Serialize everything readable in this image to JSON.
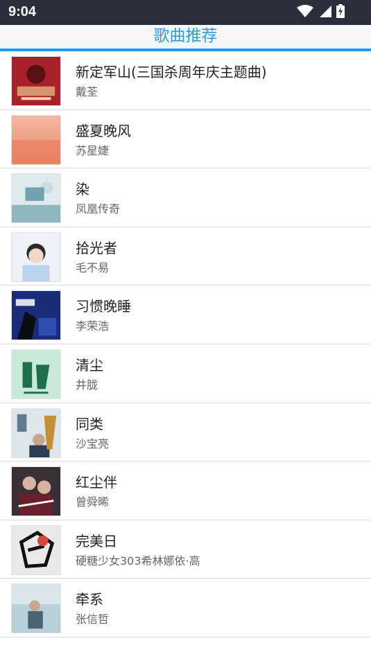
{
  "status_bar": {
    "time": "9:04",
    "icons": [
      "wifi-icon",
      "signal-icon",
      "battery-icon"
    ]
  },
  "header": {
    "title": "歌曲推荐",
    "accent_color": "#2196f3",
    "title_color": "#2d9cdb"
  },
  "songs": [
    {
      "title": "新定军山(三国杀周年庆主题曲)",
      "artist": "戴荃"
    },
    {
      "title": "盛夏晚风",
      "artist": "苏星婕"
    },
    {
      "title": "染",
      "artist": "凤凰传奇"
    },
    {
      "title": "拾光者",
      "artist": "毛不易"
    },
    {
      "title": "习惯晚睡",
      "artist": "李荣浩"
    },
    {
      "title": "清尘",
      "artist": "井胧"
    },
    {
      "title": "同类",
      "artist": "沙宝亮"
    },
    {
      "title": "红尘伴",
      "artist": "曾舜晞"
    },
    {
      "title": "完美日",
      "artist": "硬糖少女303希林娜依·高"
    },
    {
      "title": "牵系",
      "artist": "张信哲"
    }
  ]
}
